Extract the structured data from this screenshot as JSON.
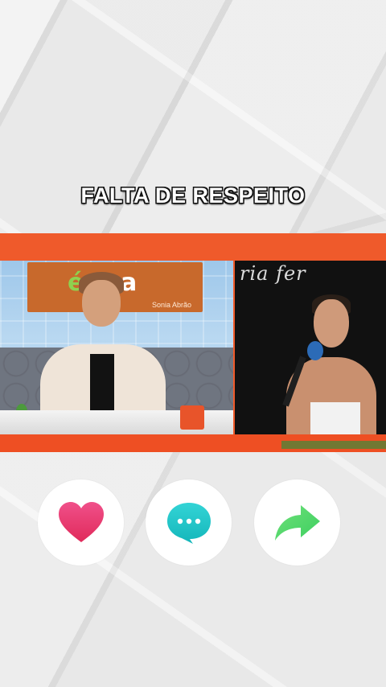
{
  "headline": "FALTA DE RESPEITO",
  "video": {
    "studio_sign_logo": "é sua",
    "studio_sign_subtitle": "Sonia Abrão",
    "guest_backdrop_text": "ria fer"
  },
  "actions": {
    "like_icon": "heart-icon",
    "comment_icon": "chat-bubble-icon",
    "share_icon": "share-arrow-icon"
  },
  "colors": {
    "accent_orange": "#ef5a2b",
    "heart_pink": "#e8386e",
    "comment_teal": "#22c6c9",
    "share_green": "#52d86b"
  }
}
